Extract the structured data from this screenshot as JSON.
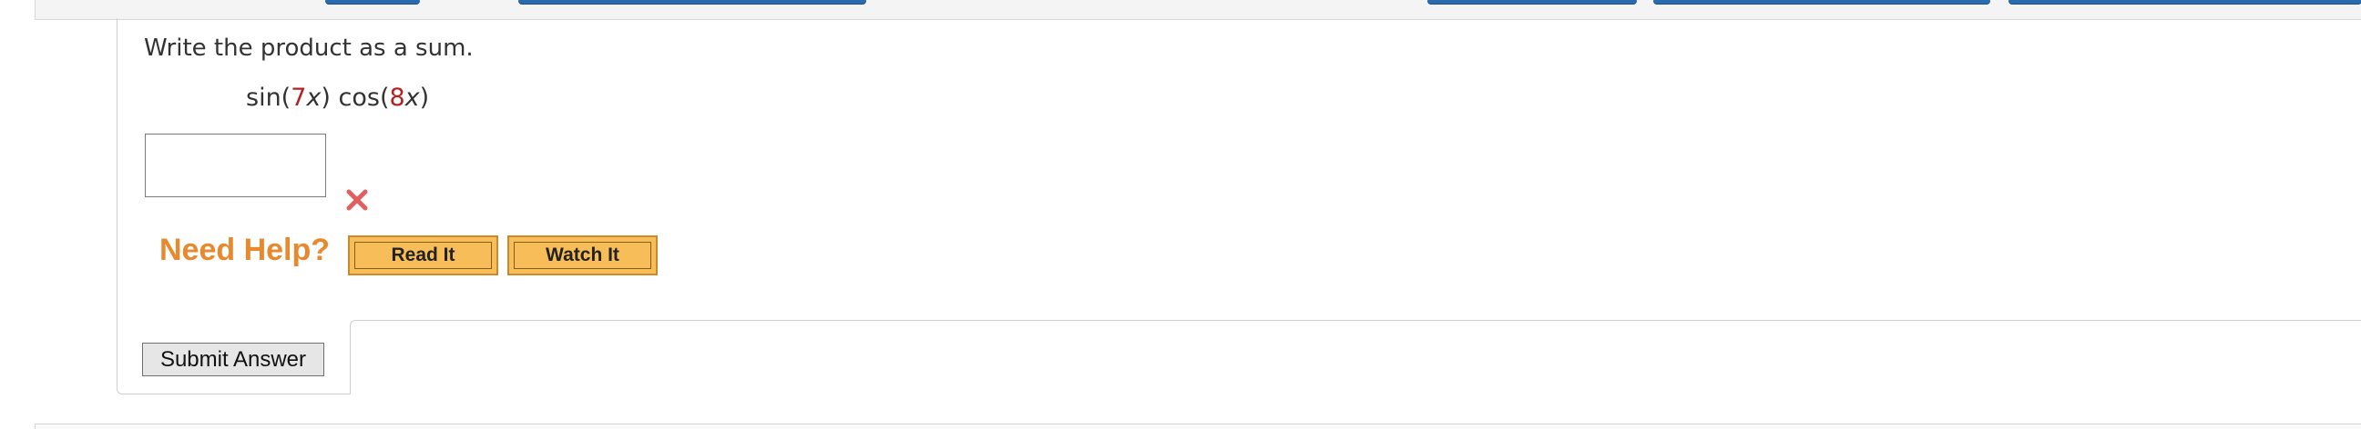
{
  "question": {
    "prompt": "Write the product as a sum.",
    "expression": {
      "f1": "sin(",
      "a1": "7",
      "v1": "x",
      "c1": ") cos(",
      "a2": "8",
      "v2": "x",
      "c2": ")"
    },
    "answer": {
      "value": "",
      "placeholder": ""
    }
  },
  "help": {
    "label": "Need Help?",
    "read_it": "Read It",
    "watch_it": "Watch It"
  },
  "submit_label": "Submit Answer",
  "colors": {
    "accent_orange": "#e8892d",
    "button_orange": "#f6bd58",
    "incorrect_red": "#e06060",
    "toolbar_blue": "#2a6bb0"
  }
}
